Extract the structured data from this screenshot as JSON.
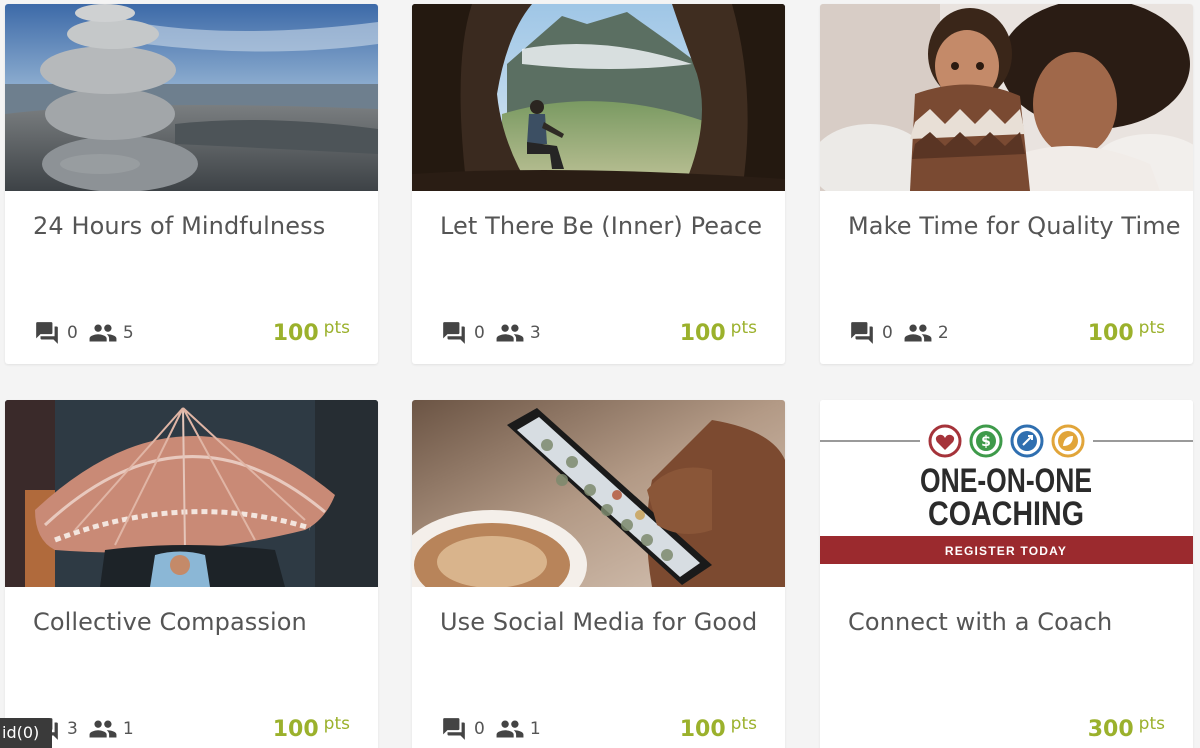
{
  "cards": [
    {
      "title": "24 Hours of Mindfulness",
      "image": "stacked-stones-seaside-photo",
      "comments": "0",
      "participants": "5",
      "points": "100",
      "points_unit": "pts"
    },
    {
      "title": "Let There Be (Inner) Peace",
      "image": "man-in-cave-mountain-view-photo",
      "comments": "0",
      "participants": "3",
      "points": "100",
      "points_unit": "pts"
    },
    {
      "title": "Make Time for Quality Time",
      "image": "mother-and-child-photo",
      "comments": "0",
      "participants": "2",
      "points": "100",
      "points_unit": "pts"
    },
    {
      "title": "Collective Compassion",
      "image": "umbrella-street-photo",
      "comments": "3",
      "participants": "1",
      "points": "100",
      "points_unit": "pts"
    },
    {
      "title": "Use Social Media for Good",
      "image": "phone-and-coffee-photo",
      "comments": "0",
      "participants": "1",
      "points": "100",
      "points_unit": "pts"
    },
    {
      "title": "Connect with a Coach",
      "image": "one-on-one-coaching-banner",
      "banner": {
        "line1": "ONE-ON-ONE",
        "line2": "COACHING",
        "cta": "REGISTER TODAY"
      },
      "points": "300",
      "points_unit": "pts"
    }
  ],
  "debug_tag": "id(0)",
  "icons": {
    "comments": "forum-icon",
    "participants": "people-icon"
  },
  "colors": {
    "points": "#9bb12c",
    "text": "#555555",
    "banner_red": "#9b2a2e"
  }
}
